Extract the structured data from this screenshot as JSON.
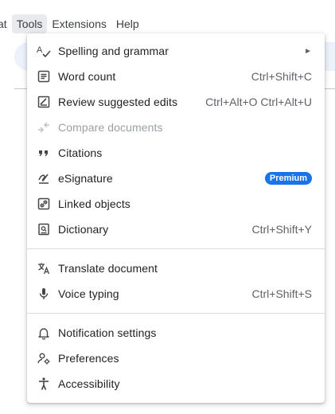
{
  "menubar": {
    "items": [
      {
        "label": "at"
      },
      {
        "label": "Tools"
      },
      {
        "label": "Extensions"
      },
      {
        "label": "Help"
      }
    ]
  },
  "tools_menu": {
    "groups": [
      [
        {
          "label": "Spelling and grammar",
          "icon": "spellcheck-icon",
          "submenu": true,
          "submenu_glyph": "►"
        },
        {
          "label": "Word count",
          "icon": "word-count-icon",
          "shortcut": "Ctrl+Shift+C"
        },
        {
          "label": "Review suggested edits",
          "icon": "review-edits-icon",
          "shortcut": "Ctrl+Alt+O Ctrl+Alt+U"
        },
        {
          "label": "Compare documents",
          "icon": "compare-icon",
          "disabled": true
        },
        {
          "label": "Citations",
          "icon": "quote-icon"
        },
        {
          "label": "eSignature",
          "icon": "signature-icon",
          "badge": "Premium"
        },
        {
          "label": "Linked objects",
          "icon": "linked-objects-icon"
        },
        {
          "label": "Dictionary",
          "icon": "dictionary-icon",
          "shortcut": "Ctrl+Shift+Y"
        }
      ],
      [
        {
          "label": "Translate document",
          "icon": "translate-icon"
        },
        {
          "label": "Voice typing",
          "icon": "microphone-icon",
          "shortcut": "Ctrl+Shift+S"
        }
      ],
      [
        {
          "label": "Notification settings",
          "icon": "bell-icon"
        },
        {
          "label": "Preferences",
          "icon": "preferences-icon"
        },
        {
          "label": "Accessibility",
          "icon": "accessibility-icon"
        }
      ]
    ]
  },
  "colors": {
    "accent": "#1a73e8",
    "menu_text": "#1f1f1f",
    "disabled_text": "#9aa0a6",
    "shortcut_text": "#5f6368",
    "active_menubar_bg": "#e8eaed"
  }
}
